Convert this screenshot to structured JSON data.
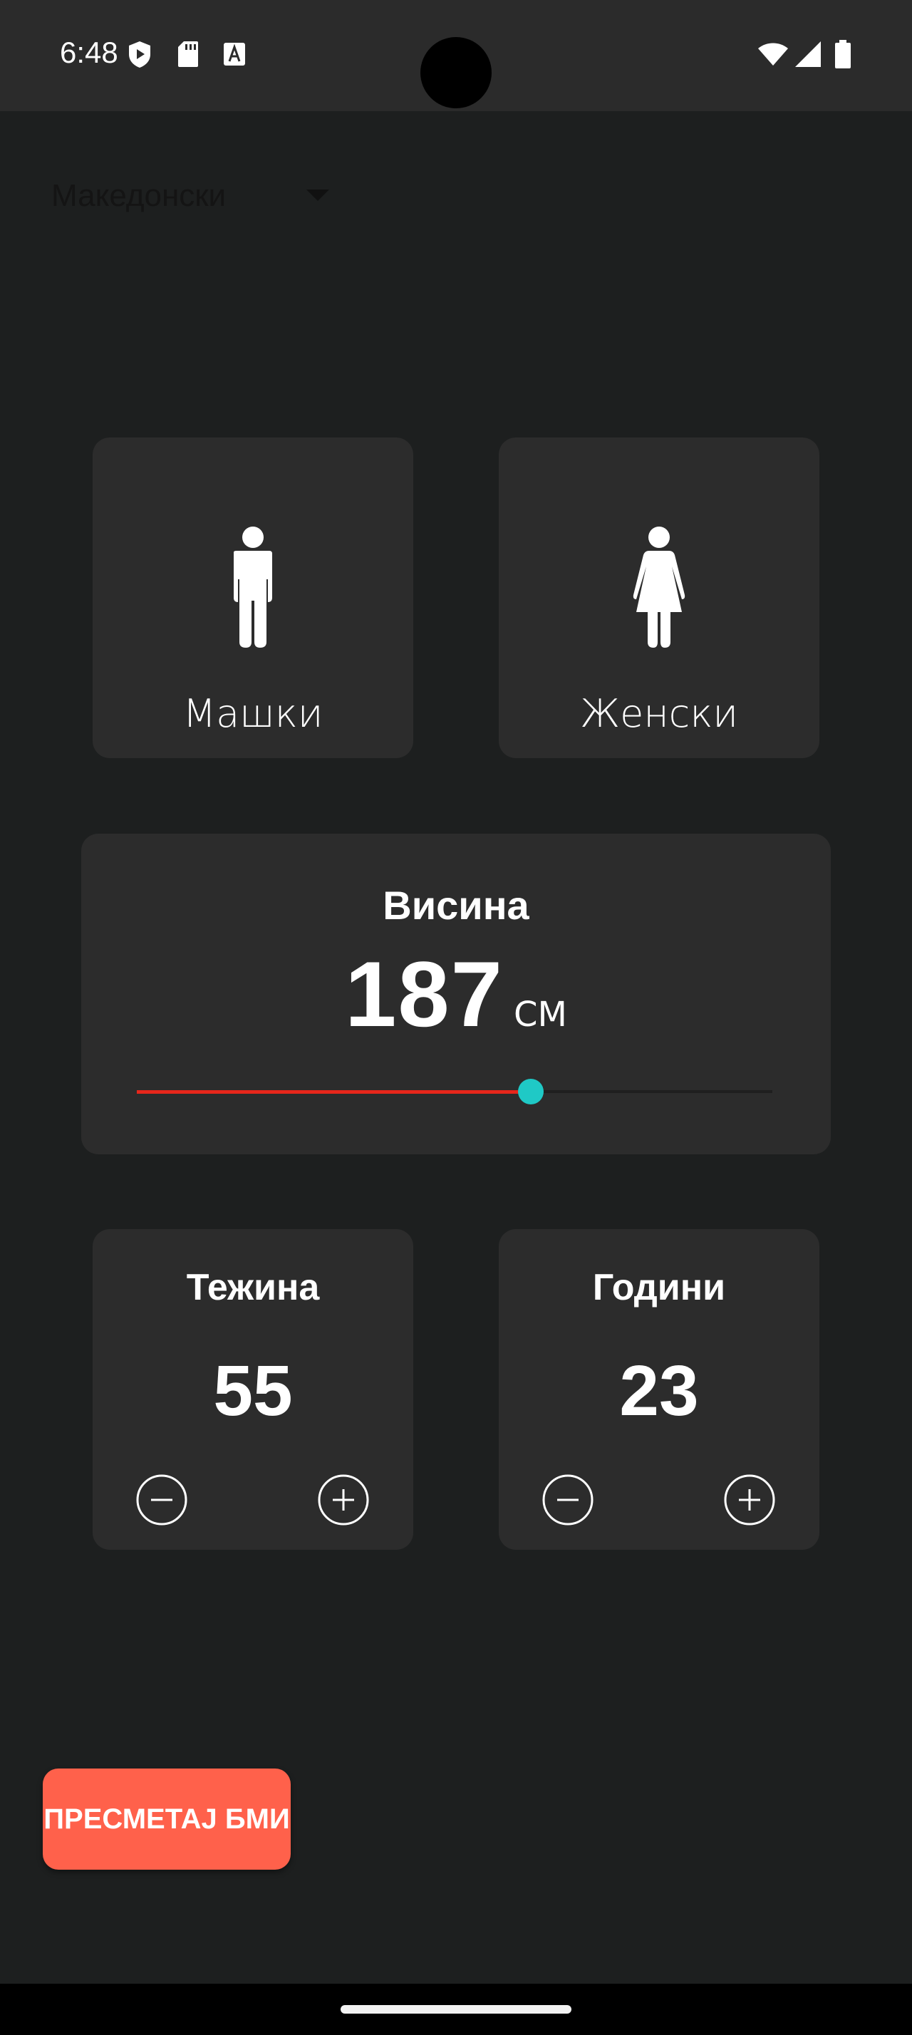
{
  "status_bar": {
    "time": "6:48",
    "icons_left": [
      "shield-play-icon",
      "sd-card-icon",
      "keyboard-a-icon"
    ],
    "icons_right": [
      "wifi-icon",
      "signal-icon",
      "battery-icon"
    ]
  },
  "language_select": {
    "value": "Македонски",
    "icon": "dropdown-arrow-icon"
  },
  "gender": {
    "male_label": "Машки",
    "female_label": "Женски",
    "male_icon": "male-figure-icon",
    "female_icon": "female-figure-icon"
  },
  "height": {
    "title": "Висина",
    "value": "187",
    "unit": "CM",
    "slider_fraction": 0.62
  },
  "weight": {
    "title": "Тежина",
    "value": "55"
  },
  "age": {
    "title": "Години",
    "value": "23"
  },
  "actions": {
    "calculate_label": "ПРЕСМЕТАЈ БМИ"
  },
  "colors": {
    "background": "#1d1f1f",
    "card": "#2c2c2c",
    "slider_active": "#e7261b",
    "slider_thumb": "#1fc9c6",
    "button": "#ff614b"
  }
}
